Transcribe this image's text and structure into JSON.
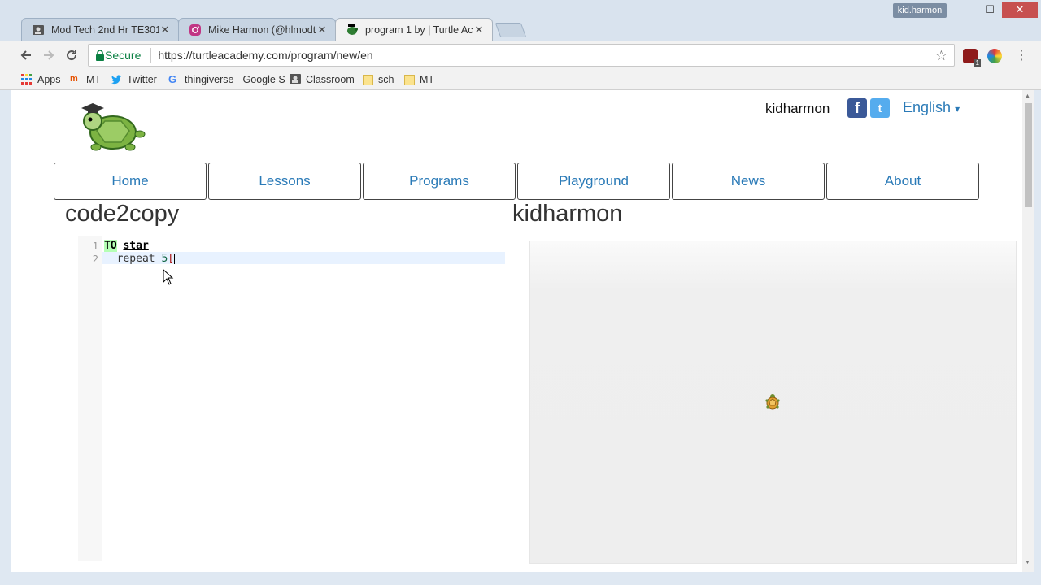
{
  "browser": {
    "tabs": [
      {
        "label": "Mod Tech 2nd Hr TE301",
        "icon": "classroom-icon",
        "close": "✕"
      },
      {
        "label": "Mike Harmon (@hlmodt",
        "icon": "instagram-icon",
        "close": "✕"
      },
      {
        "label": "program 1 by | Turtle Ac",
        "icon": "turtle-icon",
        "close": "✕",
        "active": true
      }
    ],
    "profile_name": "kid.harmon",
    "window_buttons": {
      "minimize": "—",
      "maximize": "☐",
      "close": "✕"
    },
    "secure_label": "Secure",
    "url": "https://turtleacademy.com/program/new/en",
    "bookmarks": [
      {
        "label": "Apps",
        "icon": "apps-grid-icon"
      },
      {
        "label": "MT",
        "icon": "mt-icon"
      },
      {
        "label": "Twitter",
        "icon": "twitter-icon"
      },
      {
        "label": "thingiverse - Google S",
        "icon": "google-icon"
      },
      {
        "label": "Classroom",
        "icon": "classroom-icon"
      },
      {
        "label": "sch",
        "icon": "folder-icon"
      },
      {
        "label": "MT",
        "icon": "folder-icon"
      }
    ],
    "extension_badge": "1"
  },
  "site": {
    "username": "kidharmon",
    "language": "English",
    "language_caret": "▾",
    "nav": [
      "Home",
      "Lessons",
      "Programs",
      "Playground",
      "News",
      "About"
    ],
    "program_title": "code2copy",
    "canvas_owner": "kidharmon",
    "editor": {
      "line_numbers": [
        "1",
        "2"
      ],
      "lines": [
        {
          "keyword": "TO",
          "name": "star"
        },
        {
          "indent": "  ",
          "command": "repeat",
          "arg": "5",
          "bracket": "["
        }
      ]
    }
  },
  "colors": {
    "link_blue": "#2a7ab7",
    "secure_green": "#0b8043",
    "keyword_bg": "#b5ffb5"
  }
}
